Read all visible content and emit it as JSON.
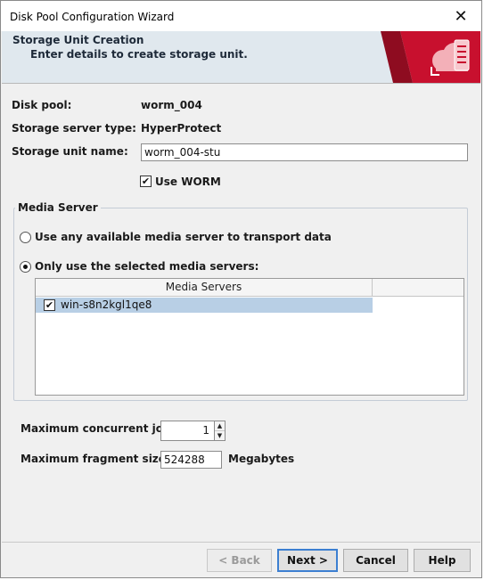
{
  "window": {
    "title": "Disk Pool Configuration Wizard",
    "close_glyph": "✕"
  },
  "banner": {
    "heading": "Storage Unit Creation",
    "subheading": "Enter details to create storage unit.",
    "logo_icon": "cloud-storage-icon",
    "accent": "#c8102e"
  },
  "form": {
    "disk_pool_label": "Disk pool:",
    "disk_pool_value": "worm_004",
    "server_type_label": "Storage server type:",
    "server_type_value": "HyperProtect",
    "unit_name_label": "Storage unit name:",
    "unit_name_value": "worm_004-stu",
    "use_worm_label": "Use WORM",
    "use_worm_checked": true
  },
  "media_server": {
    "group_title": "Media Server",
    "option_any": "Use any available media server to transport data",
    "option_selected": "Only use the selected media servers:",
    "selected_option": "selected",
    "table_header": "Media Servers",
    "rows": [
      {
        "name": "win-s8n2kgl1qe8",
        "checked": true
      }
    ]
  },
  "limits": {
    "max_jobs_label": "Maximum concurrent jobs:",
    "max_jobs_value": "1",
    "max_fragment_label": "Maximum fragment size:",
    "max_fragment_value": "524288",
    "fragment_unit": "Megabytes"
  },
  "buttons": {
    "back": "< Back",
    "next": "Next >",
    "cancel": "Cancel",
    "help": "Help"
  }
}
